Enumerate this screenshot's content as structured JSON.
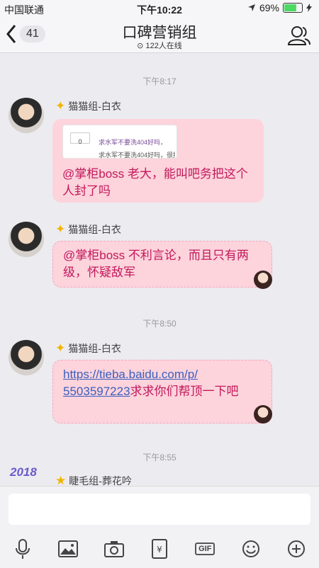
{
  "status_bar": {
    "carrier": "中国联通",
    "time": "下午10:22",
    "battery": "69%",
    "battery_level": 0.69
  },
  "nav": {
    "unread_count": "41",
    "title": "口碑营销组",
    "online": "122人在线"
  },
  "timestamps": [
    "下午8:17",
    "下午8:50",
    "下午8:55"
  ],
  "messages": [
    {
      "sender": "猫猫组-白衣",
      "quote": {
        "number": "0",
        "line1": "求水军不要洗404好吗，",
        "line2": "求水军不要洗404好吗，很损"
      },
      "text": "@掌柜boss 老大，能叫吧务把这个人封了吗"
    },
    {
      "sender": "猫猫组-白衣",
      "text": "@掌柜boss 不利言论，而且只有两级，怀疑敌军"
    },
    {
      "sender": "猫猫组-白衣",
      "link1": "https://tieba.baidu.com/p/",
      "link2": "5503597223",
      "text_after": "求求你们帮顶一下吧"
    },
    {
      "sender": "睫毛组-葬花吟",
      "badge": "2018"
    }
  ],
  "input": {
    "value": ""
  },
  "toolbar": [
    "mic-icon",
    "image-icon",
    "camera-icon",
    "red-packet-icon",
    "gif-icon",
    "emoji-icon",
    "plus-icon"
  ],
  "gif_label": "GIF",
  "colors": {
    "bubble": "#fdd3dc",
    "bubble_text": "#c2185b",
    "link": "#3a5fbf",
    "background": "#ebebf0"
  }
}
